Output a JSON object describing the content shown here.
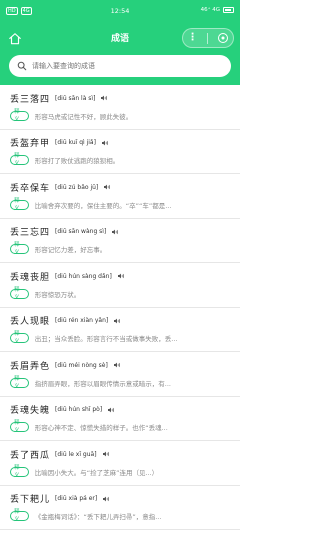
{
  "status_bar": {
    "left_badges": [
      "HD",
      "4G"
    ],
    "time": "12:54",
    "right_text": "46⁺ 4G",
    "battery": "battery-icon"
  },
  "navbar": {
    "title": "成语",
    "home_icon": "home-icon",
    "more_icon": "more-dots-icon",
    "close_icon": "close-circle-icon"
  },
  "search": {
    "placeholder": "请输入要查询的成语"
  },
  "colors": {
    "brand": "#26d07c",
    "tag": "#26c47a",
    "desc": "#8a8a8a"
  },
  "items": [
    {
      "word": "丢三落四",
      "pinyin": "[diū sān là sì]",
      "tag": "释义",
      "desc": "形容马虎或记性不好，顾此失彼。"
    },
    {
      "word": "丢盔弃甲",
      "pinyin": "[diū kuī qì jiǎ]",
      "tag": "释义",
      "desc": "形容打了败仗逃跑的狼狈相。"
    },
    {
      "word": "丢卒保车",
      "pinyin": "[diū zú bǎo jū]",
      "tag": "释义",
      "desc": "比喻舍弃次要的，保住主要的。“卒”“车”都是..."
    },
    {
      "word": "丢三忘四",
      "pinyin": "[diū sān wàng sì]",
      "tag": "释义",
      "desc": "形容记忆力差，好忘事。"
    },
    {
      "word": "丢魂丧胆",
      "pinyin": "[diū hún sàng dǎn]",
      "tag": "释义",
      "desc": "形容惊恐万状。"
    },
    {
      "word": "丢人现眼",
      "pinyin": "[diū rén xiàn yǎn]",
      "tag": "释义",
      "desc": "出丑；当众丢脸。形容言行不当或做事失败，丢..."
    },
    {
      "word": "丢眉弄色",
      "pinyin": "[diū méi nòng sè]",
      "tag": "释义",
      "desc": "指挤眉弄眼，形容以眉眼传情示意或暗示，有..."
    },
    {
      "word": "丢魂失魄",
      "pinyin": "[diū hún shī pò]",
      "tag": "释义",
      "desc": "形容心神不定、惊慌失措的样子。也作“丢魂..."
    },
    {
      "word": "丢了西瓜",
      "pinyin": "[diū le xī guā]",
      "tag": "释义",
      "desc": "比喻因小失大。与“捡了芝麻”连用（见...）"
    },
    {
      "word": "丢下耙儿",
      "pinyin": "[diū xià pá er]",
      "tag": "释义",
      "desc": "《金瓶梅词话》：“丢下耙儿弄扫帚”，意指..."
    }
  ]
}
